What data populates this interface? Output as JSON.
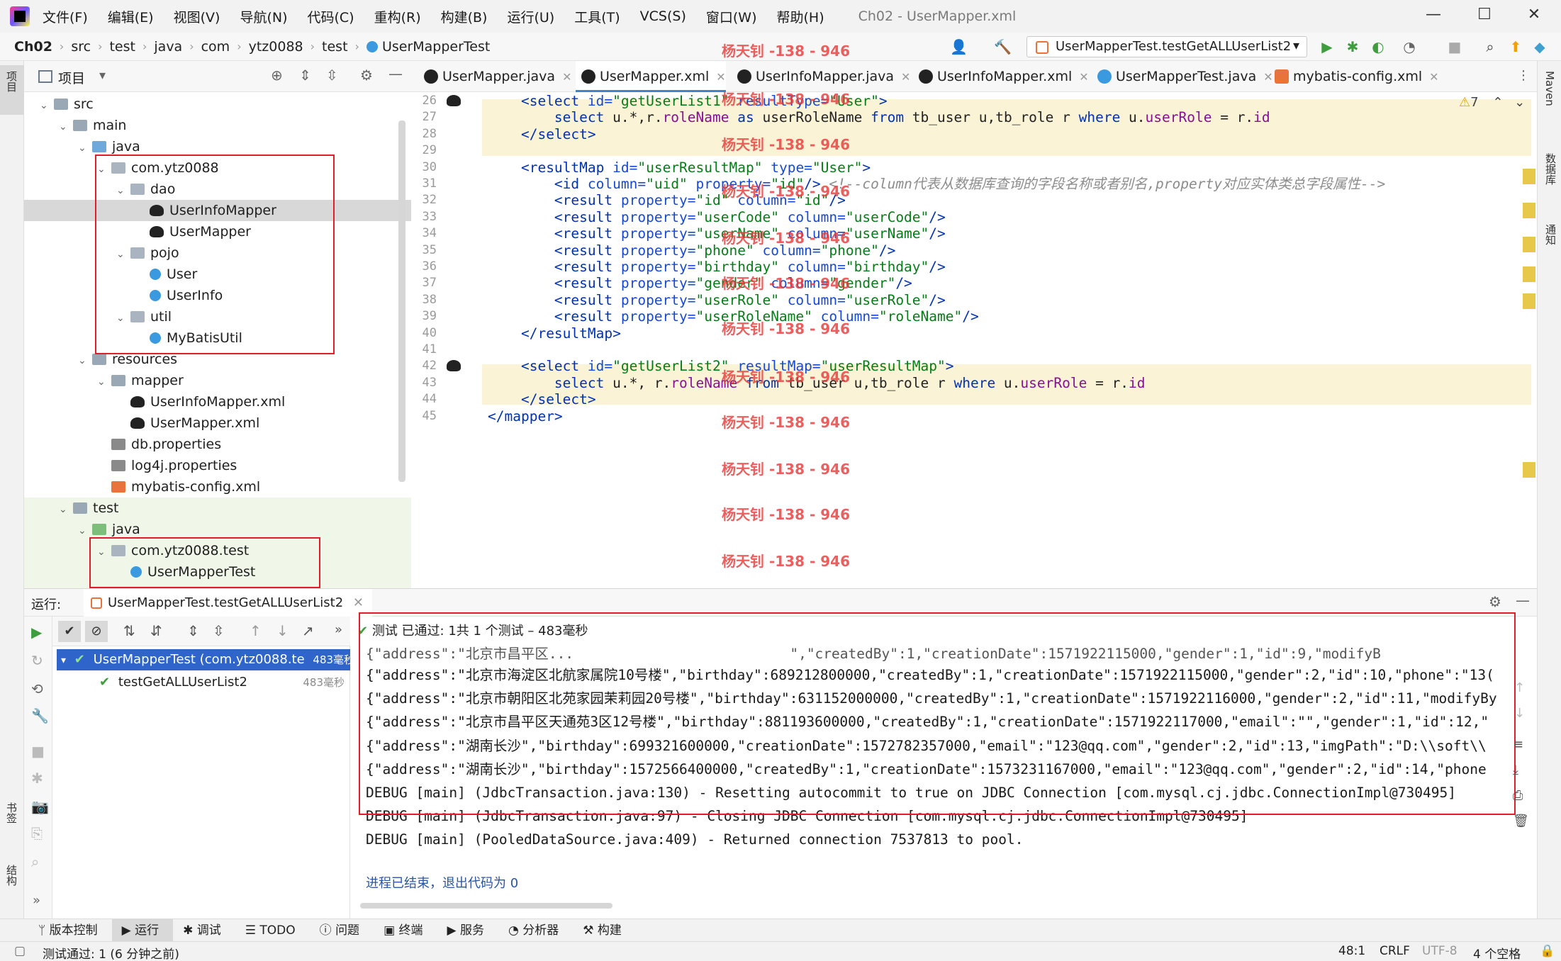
{
  "app": {
    "menu": [
      "文件(F)",
      "编辑(E)",
      "视图(V)",
      "导航(N)",
      "代码(C)",
      "重构(R)",
      "构建(B)",
      "运行(U)",
      "工具(T)",
      "VCS(S)",
      "窗口(W)",
      "帮助(H)"
    ],
    "window_title": "Ch02 - UserMapper.xml"
  },
  "breadcrumb": [
    "Ch02",
    "src",
    "test",
    "java",
    "com",
    "ytz0088",
    "test",
    "UserMapperTest"
  ],
  "run_config": "UserMapperTest.testGetALLUserList2",
  "left_strip": {
    "project": "项目",
    "bookmarks": "书签",
    "structure": "结构"
  },
  "right_strip": {
    "maven": "Maven",
    "database": "数据库",
    "notifications": "通知"
  },
  "project": {
    "title": "项目",
    "tree": [
      {
        "label": "src",
        "depth": 0,
        "type": "folder",
        "expanded": true
      },
      {
        "label": "main",
        "depth": 1,
        "type": "folder",
        "expanded": true
      },
      {
        "label": "java",
        "depth": 2,
        "type": "folder-src",
        "expanded": true
      },
      {
        "label": "com.ytz0088",
        "depth": 3,
        "type": "pkg",
        "expanded": true
      },
      {
        "label": "dao",
        "depth": 4,
        "type": "pkg",
        "expanded": true
      },
      {
        "label": "UserInfoMapper",
        "depth": 5,
        "type": "mybatis",
        "selected": true
      },
      {
        "label": "UserMapper",
        "depth": 5,
        "type": "mybatis"
      },
      {
        "label": "pojo",
        "depth": 4,
        "type": "pkg",
        "expanded": true
      },
      {
        "label": "User",
        "depth": 5,
        "type": "cls"
      },
      {
        "label": "UserInfo",
        "depth": 5,
        "type": "cls"
      },
      {
        "label": "util",
        "depth": 4,
        "type": "pkg",
        "expanded": true
      },
      {
        "label": "MyBatisUtil",
        "depth": 5,
        "type": "cls"
      },
      {
        "label": "resources",
        "depth": 2,
        "type": "folder",
        "expanded": true
      },
      {
        "label": "mapper",
        "depth": 3,
        "type": "folder",
        "expanded": true
      },
      {
        "label": "UserInfoMapper.xml",
        "depth": 4,
        "type": "mybatis"
      },
      {
        "label": "UserMapper.xml",
        "depth": 4,
        "type": "mybatis"
      },
      {
        "label": "db.properties",
        "depth": 3,
        "type": "props"
      },
      {
        "label": "log4j.properties",
        "depth": 3,
        "type": "props"
      },
      {
        "label": "mybatis-config.xml",
        "depth": 3,
        "type": "xml"
      },
      {
        "label": "test",
        "depth": 1,
        "type": "folder",
        "expanded": true
      },
      {
        "label": "java",
        "depth": 2,
        "type": "folder-test",
        "expanded": true
      },
      {
        "label": "com.ytz0088.test",
        "depth": 3,
        "type": "pkg",
        "expanded": true
      },
      {
        "label": "UserMapperTest",
        "depth": 4,
        "type": "cls"
      }
    ]
  },
  "editor": {
    "tabs": [
      {
        "label": "UserMapper.java",
        "icon": "mybatis-icon"
      },
      {
        "label": "UserMapper.xml",
        "icon": "mybatis-icon",
        "active": true
      },
      {
        "label": "UserInfoMapper.java",
        "icon": "mybatis-icon"
      },
      {
        "label": "UserInfoMapper.xml",
        "icon": "mybatis-icon"
      },
      {
        "label": "UserMapperTest.java",
        "icon": "class-icon"
      },
      {
        "label": "mybatis-config.xml",
        "icon": "xml-icon"
      }
    ],
    "warnings": "7",
    "line_numbers": [
      "26",
      "27",
      "28",
      "29",
      "30",
      "31",
      "32",
      "33",
      "34",
      "35",
      "36",
      "37",
      "38",
      "39",
      "40",
      "41",
      "42",
      "43",
      "44",
      "45"
    ]
  },
  "watermark": "杨天钊 -138 - 946",
  "run": {
    "label": "运行:",
    "config_tab": "UserMapperTest.testGetALLUserList2",
    "status": "测试 已通过: 1共 1 个测试 – 483毫秒",
    "tree": [
      {
        "label": "UserMapperTest (com.ytz0088.te",
        "time": "483毫秒"
      },
      {
        "label": "testGetALLUserList2",
        "time": "483毫秒"
      }
    ],
    "console": [
      "{\"address\":\"北京市海淀区北航家属院10号楼\",\"birthday\":689212800000,\"createdBy\":1,\"creationDate\":1571922115000,\"gender\":2,\"id\":10,\"phone\":\"13(",
      "{\"address\":\"北京市朝阳区北苑家园茉莉园20号楼\",\"birthday\":631152000000,\"createdBy\":1,\"creationDate\":1571922116000,\"gender\":2,\"id\":11,\"modifyBy",
      "{\"address\":\"北京市昌平区天通苑3区12号楼\",\"birthday\":881193600000,\"createdBy\":1,\"creationDate\":1571922117000,\"email\":\"\",\"gender\":1,\"id\":12,\"",
      "{\"address\":\"湖南长沙\",\"birthday\":699321600000,\"creationDate\":1572782357000,\"email\":\"123@qq.com\",\"gender\":2,\"id\":13,\"imgPath\":\"D:\\\\soft\\\\",
      "{\"address\":\"湖南长沙\",\"birthday\":1572566400000,\"createdBy\":1,\"creationDate\":1573231167000,\"email\":\"123@qq.com\",\"gender\":2,\"id\":14,\"phone",
      "DEBUG [main] (JdbcTransaction.java:130) - Resetting autocommit to true on JDBC Connection [com.mysql.cj.jdbc.ConnectionImpl@730495]",
      "DEBUG [main] (JdbcTransaction.java:97) - Closing JDBC Connection [com.mysql.cj.jdbc.ConnectionImpl@730495]",
      "DEBUG [main] (PooledDataSource.java:409) - Returned connection 7537813 to pool."
    ],
    "exit_message": "进程已结束，退出代码为 0"
  },
  "toolwindows": [
    "版本控制",
    "运行",
    "调试",
    "TODO",
    "问题",
    "终端",
    "服务",
    "分析器",
    "构建"
  ],
  "status": {
    "message": "测试通过: 1 (6 分钟之前)",
    "position": "48:1",
    "line_sep": "CRLF",
    "encoding": "UTF-8",
    "indent": "4 个空格"
  }
}
